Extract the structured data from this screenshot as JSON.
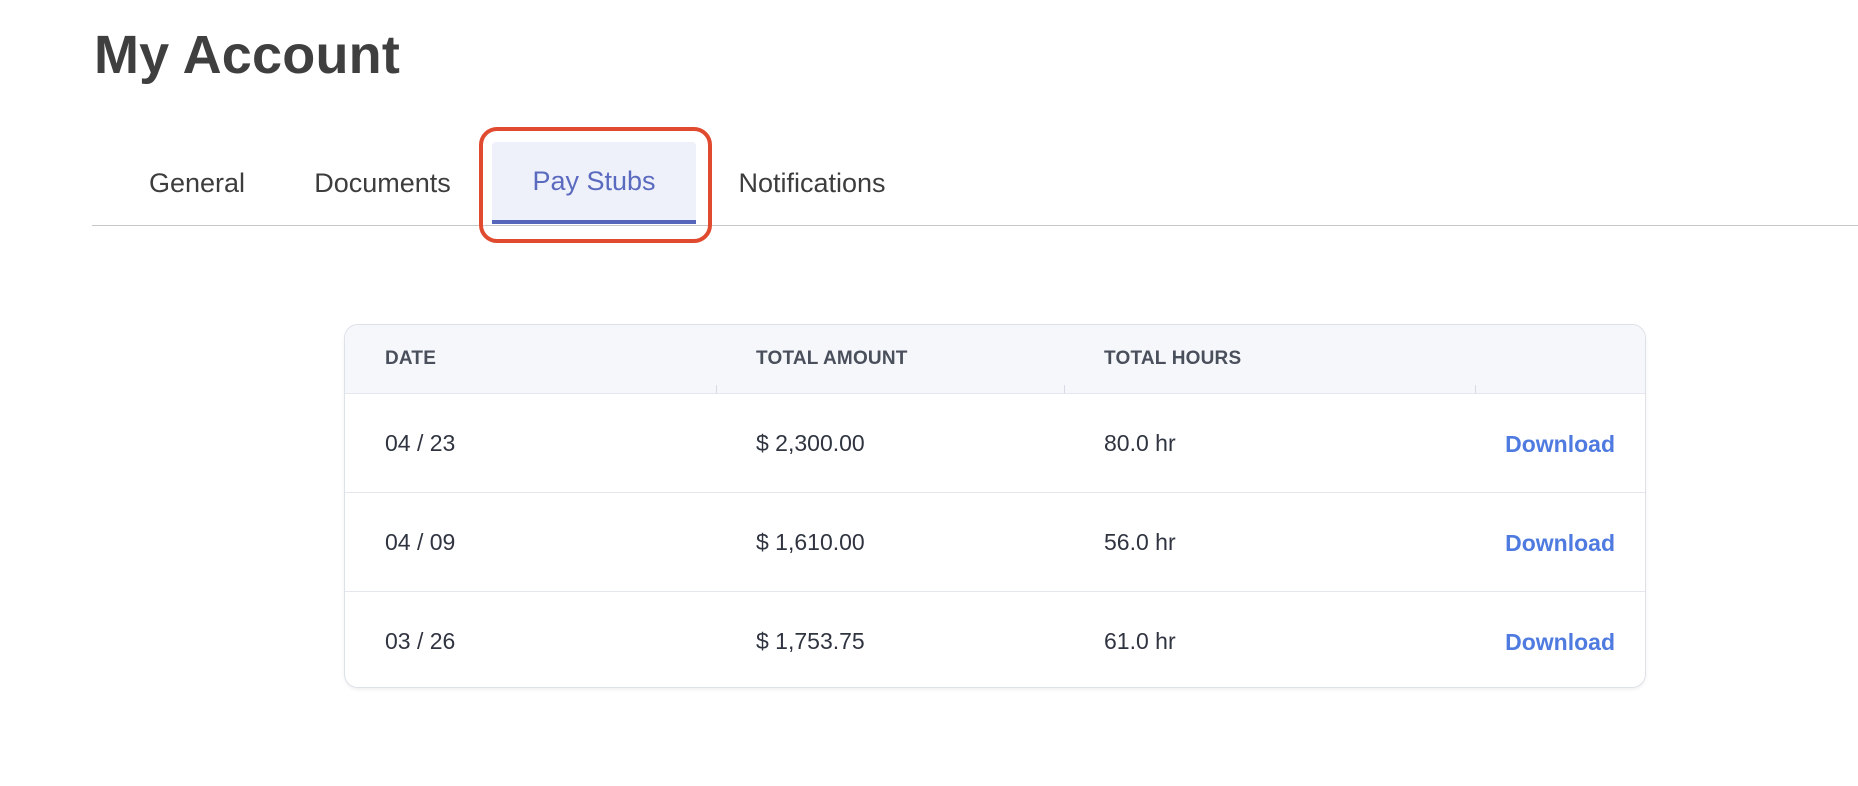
{
  "page": {
    "title": "My Account"
  },
  "tabs": [
    {
      "label": "General"
    },
    {
      "label": "Documents"
    },
    {
      "label": "Pay Stubs",
      "active": true
    },
    {
      "label": "Notifications"
    }
  ],
  "pay_stubs": {
    "columns": {
      "date": "DATE",
      "total_amount": "TOTAL AMOUNT",
      "total_hours": "TOTAL HOURS"
    },
    "rows": [
      {
        "date": "04 / 23",
        "amount": "$ 2,300.00",
        "hours": "80.0 hr",
        "action": "Download"
      },
      {
        "date": "04 / 09",
        "amount": "$ 1,610.00",
        "hours": "56.0 hr",
        "action": "Download"
      },
      {
        "date": "03 / 26",
        "amount": "$ 1,753.75",
        "hours": "61.0 hr",
        "action": "Download"
      }
    ]
  },
  "colors": {
    "accent": "#5566bb",
    "link": "#4f7be0",
    "highlight": "#e04a2f"
  }
}
